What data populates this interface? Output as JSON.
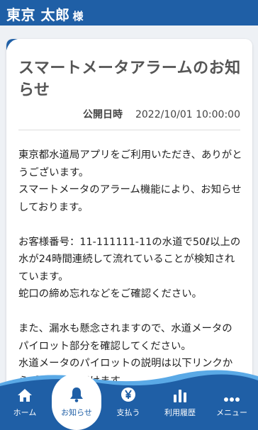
{
  "header": {
    "user_name": "東京 太郎",
    "user_suffix": "様"
  },
  "notice": {
    "title": "スマートメータアラームのお知らせ",
    "published_label": "公開日時",
    "published_at": "2022/10/01 10:00:00",
    "paragraphs": [
      "東京都水道局アプリをご利用いただき、ありがとうございます。\nスマートメータのアラーム機能により、お知らせしております。",
      "お客様番号：11-111111-11の水道で50ℓ以上の水が24時間連続して流れていることが検知されています。\n蛇口の締め忘れなどをご確認ください。",
      "また、漏水も懸念されますので、水道メータのパイロット部分を確認してください。\n水道メータのパイロットの説明は以下リンクからご確認いただけます。"
    ]
  },
  "nav": {
    "items": [
      {
        "label": "ホーム",
        "icon": "home-icon"
      },
      {
        "label": "お知らせ",
        "icon": "bell-icon",
        "active": true
      },
      {
        "label": "支払う",
        "icon": "yen-icon"
      },
      {
        "label": "利用履歴",
        "icon": "bar-chart-icon"
      },
      {
        "label": "メニュー",
        "icon": "more-dots-icon"
      }
    ]
  },
  "colors": {
    "brand": "#1f5fa6",
    "accent_wave": "#5aa9e6"
  }
}
